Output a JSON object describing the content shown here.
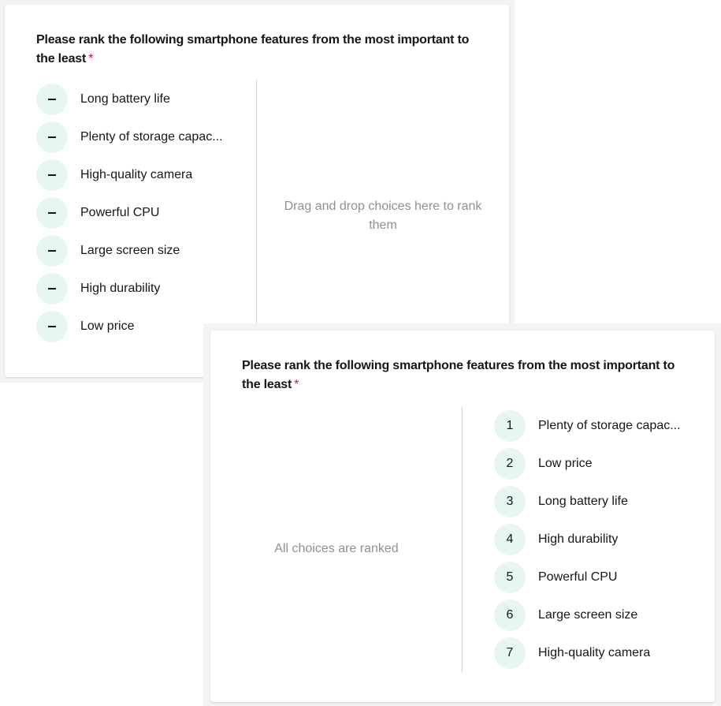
{
  "question": {
    "text": "Please rank the following smartphone features from the most important to the least",
    "required_mark": "*"
  },
  "colors": {
    "badge_bg": "#e6f6f3",
    "required": "#e50a3e",
    "hint_text": "#909090",
    "frame_bg": "#f3f3f3"
  },
  "unranked_state": {
    "choices": [
      {
        "marker": "dash-icon",
        "label": "Long battery life"
      },
      {
        "marker": "dash-icon",
        "label": "Plenty of storage capac..."
      },
      {
        "marker": "dash-icon",
        "label": "High-quality camera"
      },
      {
        "marker": "dash-icon",
        "label": "Powerful CPU"
      },
      {
        "marker": "dash-icon",
        "label": "Large screen size"
      },
      {
        "marker": "dash-icon",
        "label": "High durability"
      },
      {
        "marker": "dash-icon",
        "label": "Low price"
      }
    ],
    "drop_hint": "Drag and drop choices here to rank them"
  },
  "ranked_state": {
    "empty_hint": "All choices are ranked",
    "ranked": [
      {
        "rank": "1",
        "label": "Plenty of storage capac..."
      },
      {
        "rank": "2",
        "label": "Low price"
      },
      {
        "rank": "3",
        "label": "Long battery life"
      },
      {
        "rank": "4",
        "label": "High durability"
      },
      {
        "rank": "5",
        "label": "Powerful CPU"
      },
      {
        "rank": "6",
        "label": "Large screen size"
      },
      {
        "rank": "7",
        "label": "High-quality camera"
      }
    ]
  }
}
